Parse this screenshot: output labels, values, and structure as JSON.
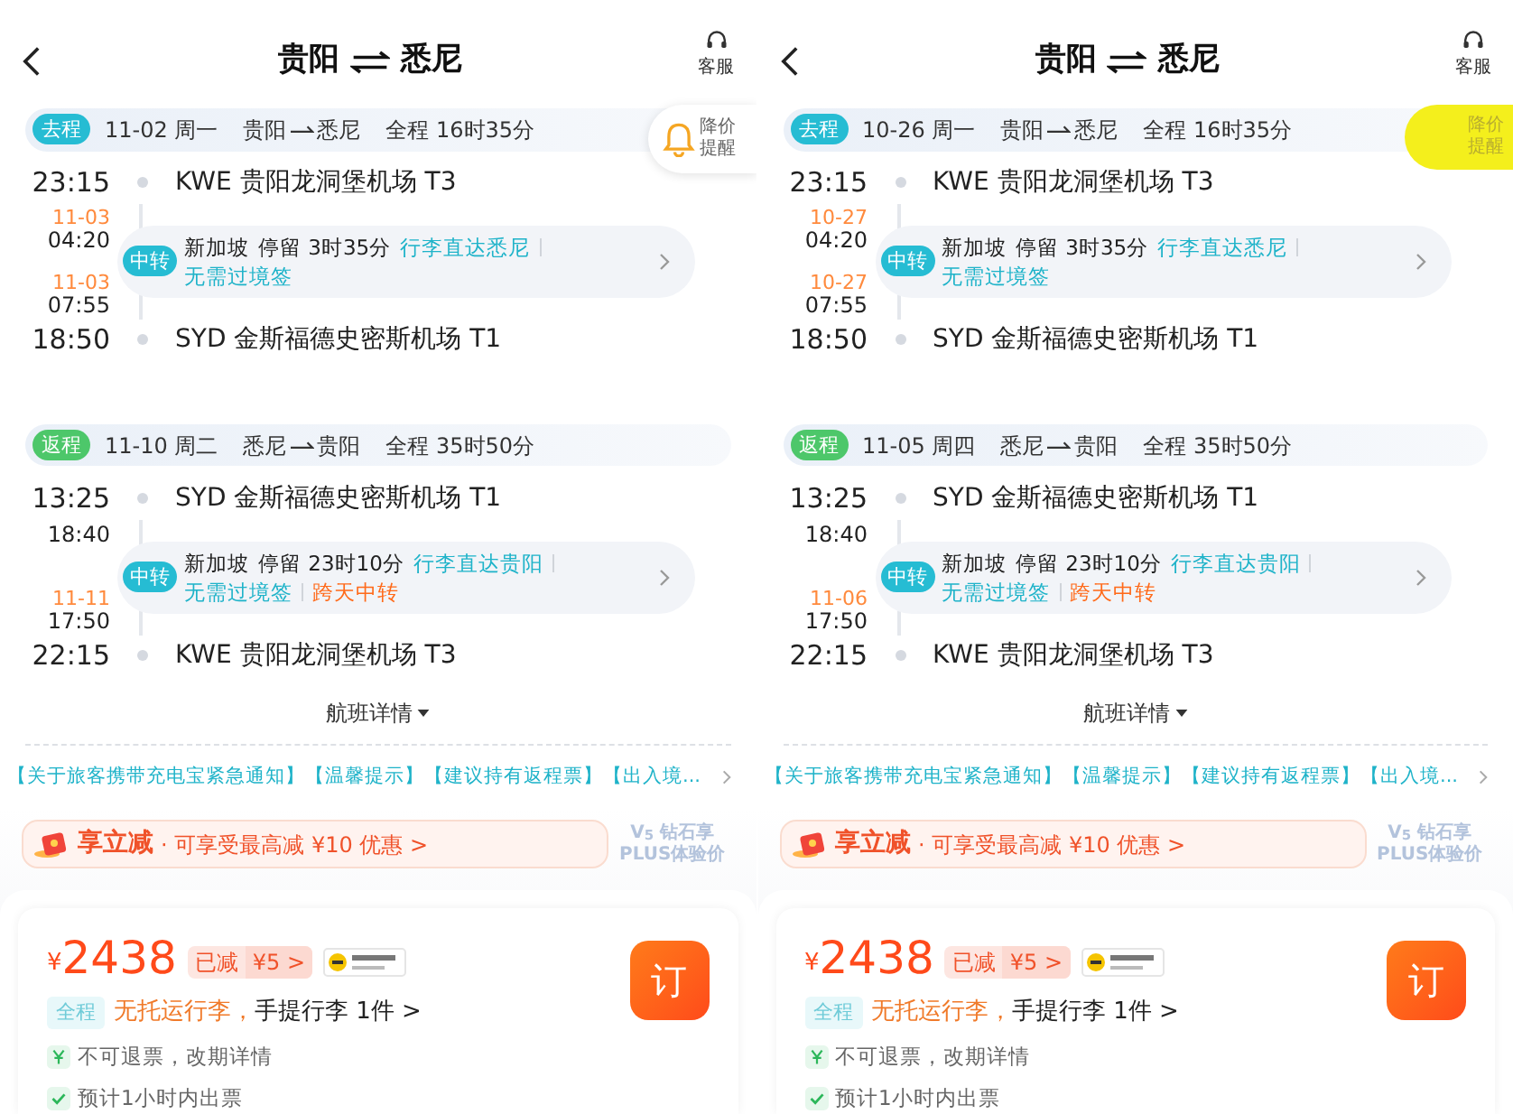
{
  "screens": [
    {
      "title_from": "贵阳",
      "title_to": "悉尼",
      "service_label": "客服",
      "price_alert": {
        "label": "降价提醒",
        "scribbled": false
      },
      "legs": [
        {
          "tag": "去程",
          "kind": "outbound",
          "date": "11-02",
          "weekday": "周一",
          "from": "贵阳",
          "to": "悉尼",
          "duration": "全程 16时35分",
          "depart_time": "23:15",
          "depart_airport": "KWE 贵阳龙洞堡机场 T3",
          "transfer": {
            "arrive_date": "11-03",
            "arrive_time": "04:20",
            "depart_date": "11-03",
            "depart_time": "07:55",
            "tag": "中转",
            "city": "新加坡",
            "stay": "停留 3时35分",
            "notes": [
              {
                "text": "行李直达悉尼",
                "kind": "info"
              },
              {
                "text": "无需过境签",
                "kind": "info"
              }
            ]
          },
          "arrive_time": "18:50",
          "arrive_airport": "SYD 金斯福德史密斯机场 T1"
        },
        {
          "tag": "返程",
          "kind": "return",
          "date": "11-10",
          "weekday": "周二",
          "from": "悉尼",
          "to": "贵阳",
          "duration": "全程 35时50分",
          "depart_time": "13:25",
          "depart_airport": "SYD 金斯福德史密斯机场 T1",
          "transfer": {
            "arrive_time": "18:40",
            "depart_date": "11-11",
            "depart_time": "17:50",
            "tag": "中转",
            "city": "新加坡",
            "stay": "停留 23时10分",
            "notes": [
              {
                "text": "行李直达贵阳",
                "kind": "info"
              },
              {
                "text": "无需过境签",
                "kind": "info"
              },
              {
                "text": "跨天中转",
                "kind": "warning"
              }
            ]
          },
          "arrive_time": "22:15",
          "arrive_airport": "KWE 贵阳龙洞堡机场 T3"
        }
      ],
      "details_link": "航班详情",
      "notice": "【关于旅客携带充电宝紧急通知】【温馨提示】【建议持有返程票】【出入境...",
      "promo": {
        "title": "享立减",
        "text": "· 可享受最高减 ¥10 优惠 >"
      },
      "plus": {
        "line1": "V$_{5}$ 钻石享",
        "line2": "PLUS体验价"
      },
      "price": {
        "currency": "¥",
        "amount": "2438",
        "discount_label": "已减",
        "discount": "¥5 >"
      },
      "baggage": {
        "tag": "全程",
        "checked": "无托运行李，",
        "carry_on": "手提行李 1件 >"
      },
      "policies": [
        {
          "kind": "refund",
          "text": "不可退票，改期详情"
        },
        {
          "kind": "ticketing",
          "text": "预计1小时内出票"
        }
      ],
      "book_label": "订"
    },
    {
      "title_from": "贵阳",
      "title_to": "悉尼",
      "service_label": "客服",
      "price_alert": {
        "label": "降价提醒",
        "scribbled": true
      },
      "legs": [
        {
          "tag": "去程",
          "kind": "outbound",
          "date": "10-26",
          "weekday": "周一",
          "from": "贵阳",
          "to": "悉尼",
          "duration": "全程 16时35分",
          "depart_time": "23:15",
          "depart_airport": "KWE 贵阳龙洞堡机场 T3",
          "transfer": {
            "arrive_date": "10-27",
            "arrive_time": "04:20",
            "depart_date": "10-27",
            "depart_time": "07:55",
            "tag": "中转",
            "city": "新加坡",
            "stay": "停留 3时35分",
            "notes": [
              {
                "text": "行李直达悉尼",
                "kind": "info"
              },
              {
                "text": "无需过境签",
                "kind": "info"
              }
            ]
          },
          "arrive_time": "18:50",
          "arrive_airport": "SYD 金斯福德史密斯机场 T1"
        },
        {
          "tag": "返程",
          "kind": "return",
          "date": "11-05",
          "weekday": "周四",
          "from": "悉尼",
          "to": "贵阳",
          "duration": "全程 35时50分",
          "depart_time": "13:25",
          "depart_airport": "SYD 金斯福德史密斯机场 T1",
          "transfer": {
            "arrive_time": "18:40",
            "depart_date": "11-06",
            "depart_time": "17:50",
            "tag": "中转",
            "city": "新加坡",
            "stay": "停留 23时10分",
            "notes": [
              {
                "text": "行李直达贵阳",
                "kind": "info"
              },
              {
                "text": "无需过境签",
                "kind": "info"
              },
              {
                "text": "跨天中转",
                "kind": "warning"
              }
            ]
          },
          "arrive_time": "22:15",
          "arrive_airport": "KWE 贵阳龙洞堡机场 T3"
        }
      ],
      "details_link": "航班详情",
      "notice": "【关于旅客携带充电宝紧急通知】【温馨提示】【建议持有返程票】【出入境...",
      "promo": {
        "title": "享立减",
        "text": "· 可享受最高减 ¥10 优惠 >"
      },
      "plus": {
        "line1": "V$_{5}$ 钻石享",
        "line2": "PLUS体验价"
      },
      "price": {
        "currency": "¥",
        "amount": "2438",
        "discount_label": "已减",
        "discount": "¥5 >"
      },
      "baggage": {
        "tag": "全程",
        "checked": "无托运行李，",
        "carry_on": "手提行李 1件 >"
      },
      "policies": [
        {
          "kind": "refund",
          "text": "不可退票，改期详情"
        },
        {
          "kind": "ticketing",
          "text": "预计1小时内出票"
        }
      ],
      "book_label": "订"
    }
  ]
}
